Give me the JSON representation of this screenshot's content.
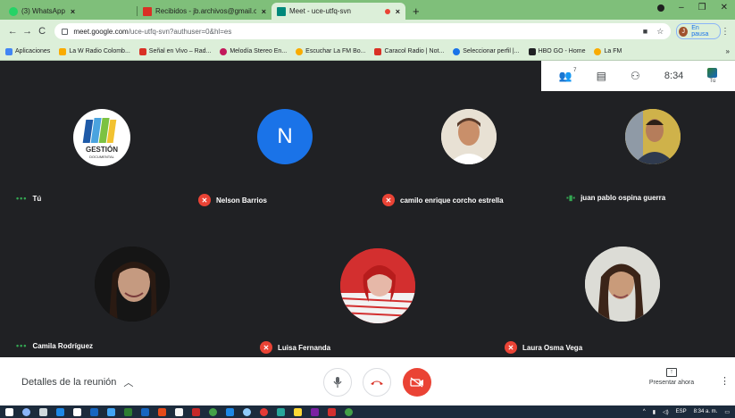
{
  "tabs": [
    {
      "title": "(3) WhatsApp",
      "color": "#25d366",
      "active": false
    },
    {
      "title": "Recibidos - jb.archivos@gmail.co",
      "color": "#d93025",
      "active": false
    },
    {
      "title": "Meet - uce-utfq-svn",
      "color": "#00897b",
      "active": true
    }
  ],
  "newtab_icon": "plus-icon",
  "url": {
    "host": "meet.google.com",
    "path": "/uce-utfq-svn?authuser=0&hl=es"
  },
  "profile": {
    "initial": "J",
    "status": "En pausa"
  },
  "bookmarks": [
    {
      "label": "Aplicaciones",
      "color": "#4285f4"
    },
    {
      "label": "La W Radio Colomb...",
      "color": "#f9ab00"
    },
    {
      "label": "Señal en Vivo – Rad...",
      "color": "#d93025"
    },
    {
      "label": "Melodía Stereo En...",
      "color": "#c2185b"
    },
    {
      "label": "Escuchar La FM Bo...",
      "color": "#f9ab00"
    },
    {
      "label": "Caracol Radio | Not...",
      "color": "#d93025"
    },
    {
      "label": "Seleccionar perfil |...",
      "color": "#1a73e8"
    },
    {
      "label": "HBO GO - Home",
      "color": "#202124"
    },
    {
      "label": "La FM",
      "color": "#f9ab00"
    }
  ],
  "bookmarks_more": "»",
  "meet_top": {
    "participant_count": "7",
    "time": "8:34",
    "self_label": "Tú"
  },
  "participants": [
    {
      "name": "Tú",
      "state": "dots"
    },
    {
      "name": "Nelson Barrios",
      "state": "muted",
      "initial": "N"
    },
    {
      "name": "camilo enrique corcho estrella",
      "state": "muted"
    },
    {
      "name": "juan pablo ospina guerra",
      "state": "speaking"
    },
    {
      "name": "Camila Rodríguez",
      "state": "dots"
    },
    {
      "name": "Luisa Fernanda",
      "state": "muted"
    },
    {
      "name": "Laura Osma Vega",
      "state": "muted"
    }
  ],
  "logo_text": {
    "line1": "GESTIÓN",
    "line2": "DOCUMENTAL"
  },
  "controls": {
    "details_label": "Detalles de la reunión",
    "present_label": "Presentar ahora"
  },
  "tray": {
    "lang": "ESP",
    "time": "8:34 a. m."
  },
  "colors": {
    "tab_strip": "#7fbf7a",
    "meet_bg": "#202124",
    "red": "#ea4335",
    "blue": "#1a73e8"
  }
}
